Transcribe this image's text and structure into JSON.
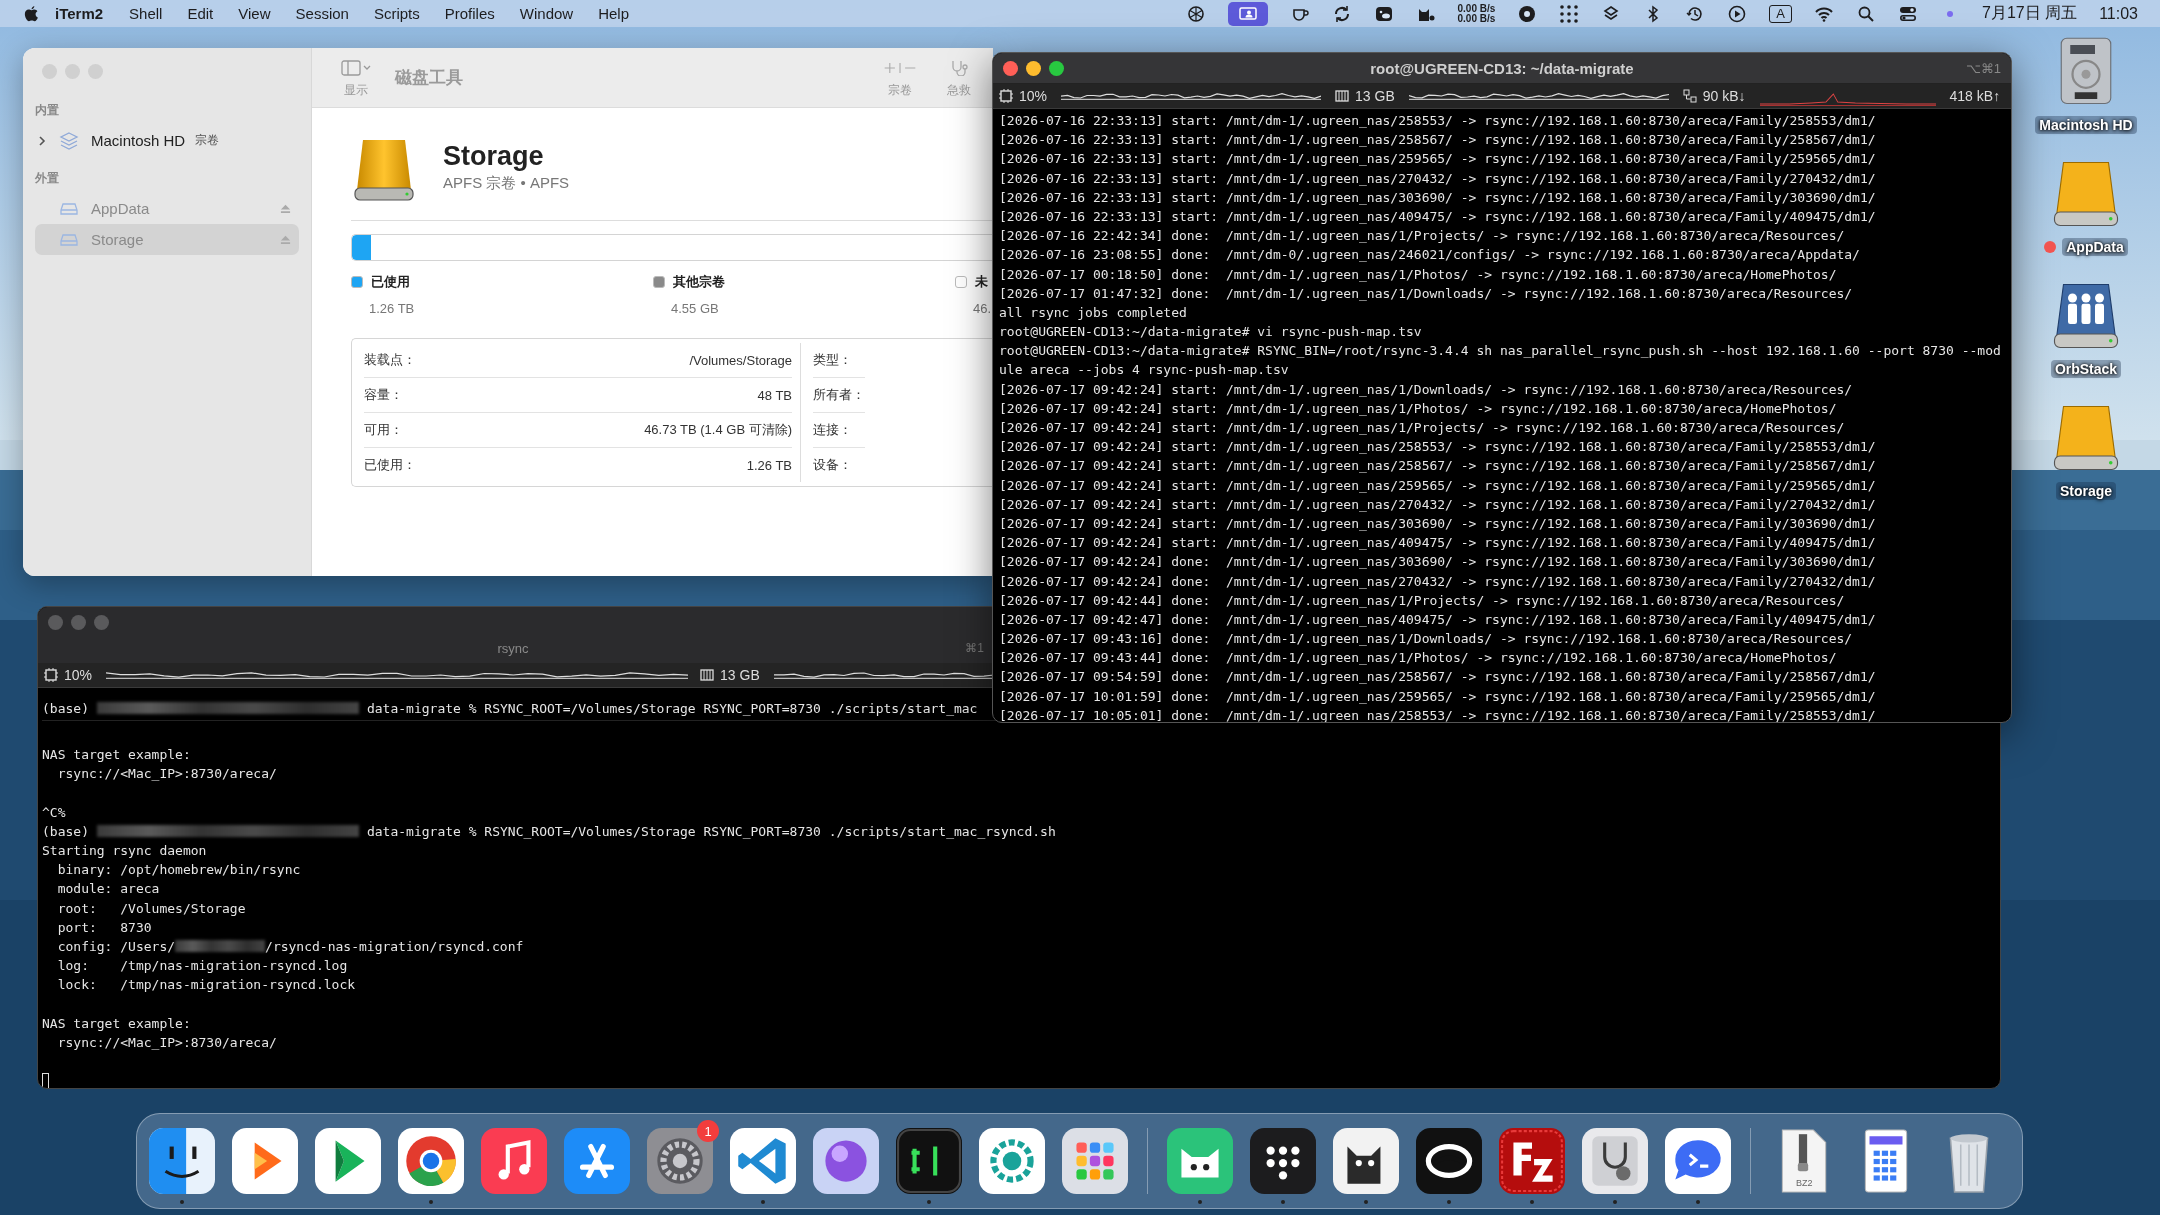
{
  "menu_bar": {
    "app_name": "iTerm2",
    "menus": [
      "Shell",
      "Edit",
      "View",
      "Session",
      "Scripts",
      "Profiles",
      "Window",
      "Help"
    ],
    "status_items": [
      {
        "kind": "icon",
        "highlighted": false
      },
      {
        "kind": "icon",
        "highlighted": true
      },
      {
        "kind": "icon",
        "highlighted": false
      },
      {
        "kind": "icon",
        "highlighted": false
      },
      {
        "kind": "icon",
        "highlighted": false
      },
      {
        "kind": "icon",
        "highlighted": false
      },
      {
        "kind": "speed",
        "lines": [
          "0.00 B/s",
          "0.00 B/s"
        ]
      },
      {
        "kind": "icon",
        "highlighted": false
      },
      {
        "kind": "icon",
        "highlighted": false
      },
      {
        "kind": "icon",
        "highlighted": false
      },
      {
        "kind": "icon",
        "highlighted": false
      },
      {
        "kind": "icon",
        "highlighted": false
      },
      {
        "kind": "icon",
        "highlighted": false
      },
      {
        "kind": "input",
        "text": "A"
      },
      {
        "kind": "icon",
        "highlighted": false
      },
      {
        "kind": "icon",
        "highlighted": false
      },
      {
        "kind": "icon",
        "highlighted": false
      },
      {
        "kind": "icon",
        "highlighted": false
      },
      {
        "kind": "text",
        "text": "7月17日 周五"
      },
      {
        "kind": "text",
        "text": "11:03"
      }
    ]
  },
  "disk_utility": {
    "title": "磁盘工具",
    "view_label": "显示",
    "volume_label": "宗卷",
    "first_aid_label": "急救",
    "sidebar": [
      {
        "heading": "内置",
        "items": [
          {
            "name": "Macintosh HD",
            "tag": "宗卷",
            "kind": "container",
            "expanded": false,
            "selected": false
          }
        ]
      },
      {
        "heading": "外置",
        "items": [
          {
            "name": "AppData",
            "kind": "volume",
            "ejectable": true,
            "selected": false
          },
          {
            "name": "Storage",
            "kind": "volume",
            "ejectable": true,
            "selected": true
          }
        ]
      }
    ],
    "volume": {
      "name": "Storage",
      "subtitle": "APFS 宗卷 • APFS"
    },
    "usage": {
      "level": 0.03,
      "legend": [
        {
          "label": "已使用",
          "value": "1.26 TB",
          "color": "#1ea5f3"
        },
        {
          "label": "其他宗卷",
          "value": "4.55 GB",
          "color": "#8a8a8a"
        },
        {
          "label": "未",
          "value": "46.",
          "color": "#ffffff"
        }
      ]
    },
    "info_left": [
      {
        "label": "装载点：",
        "value": "/Volumes/Storage"
      },
      {
        "label": "容量：",
        "value": "48 TB"
      },
      {
        "label": "可用：",
        "value": "46.73 TB (1.4 GB 可清除)"
      },
      {
        "label": "已使用：",
        "value": "1.26 TB"
      }
    ],
    "info_right": [
      "类型：",
      "所有者：",
      "连接：",
      "设备："
    ]
  },
  "terminal_front": {
    "title": "root@UGREEN-CD13: ~/data-migrate",
    "shortcut": "⌥⌘1",
    "status_bar": [
      {
        "kind": "cpu",
        "text": "10%"
      },
      {
        "kind": "memory",
        "text": "13 GB"
      },
      {
        "kind": "network",
        "text": "90 kB↓",
        "text2": "418 kB↑"
      }
    ],
    "lines": [
      "[2026-07-16 22:33:13] start: /mnt/dm-1/.ugreen_nas/258553/ -> rsync://192.168.1.60:8730/areca/Family/258553/dm1/",
      "[2026-07-16 22:33:13] start: /mnt/dm-1/.ugreen_nas/258567/ -> rsync://192.168.1.60:8730/areca/Family/258567/dm1/",
      "[2026-07-16 22:33:13] start: /mnt/dm-1/.ugreen_nas/259565/ -> rsync://192.168.1.60:8730/areca/Family/259565/dm1/",
      "[2026-07-16 22:33:13] start: /mnt/dm-1/.ugreen_nas/270432/ -> rsync://192.168.1.60:8730/areca/Family/270432/dm1/",
      "[2026-07-16 22:33:13] start: /mnt/dm-1/.ugreen_nas/303690/ -> rsync://192.168.1.60:8730/areca/Family/303690/dm1/",
      "[2026-07-16 22:33:13] start: /mnt/dm-1/.ugreen_nas/409475/ -> rsync://192.168.1.60:8730/areca/Family/409475/dm1/",
      "[2026-07-16 22:42:34] done:  /mnt/dm-1/.ugreen_nas/1/Projects/ -> rsync://192.168.1.60:8730/areca/Resources/",
      "[2026-07-16 23:08:55] done:  /mnt/dm-0/.ugreen_nas/246021/configs/ -> rsync://192.168.1.60:8730/areca/Appdata/",
      "[2026-07-17 00:18:50] done:  /mnt/dm-1/.ugreen_nas/1/Photos/ -> rsync://192.168.1.60:8730/areca/HomePhotos/",
      "[2026-07-17 01:47:32] done:  /mnt/dm-1/.ugreen_nas/1/Downloads/ -> rsync://192.168.1.60:8730/areca/Resources/",
      "all rsync jobs completed",
      "root@UGREEN-CD13:~/data-migrate# vi rsync-push-map.tsv",
      "root@UGREEN-CD13:~/data-migrate# RSYNC_BIN=/root/rsync-3.4.4 sh nas_parallel_rsync_push.sh --host 192.168.1.60 --port 8730 --mod",
      "ule areca --jobs 4 rsync-push-map.tsv",
      "[2026-07-17 09:42:24] start: /mnt/dm-1/.ugreen_nas/1/Downloads/ -> rsync://192.168.1.60:8730/areca/Resources/",
      "[2026-07-17 09:42:24] start: /mnt/dm-1/.ugreen_nas/1/Photos/ -> rsync://192.168.1.60:8730/areca/HomePhotos/",
      "[2026-07-17 09:42:24] start: /mnt/dm-1/.ugreen_nas/1/Projects/ -> rsync://192.168.1.60:8730/areca/Resources/",
      "[2026-07-17 09:42:24] start: /mnt/dm-1/.ugreen_nas/258553/ -> rsync://192.168.1.60:8730/areca/Family/258553/dm1/",
      "[2026-07-17 09:42:24] start: /mnt/dm-1/.ugreen_nas/258567/ -> rsync://192.168.1.60:8730/areca/Family/258567/dm1/",
      "[2026-07-17 09:42:24] start: /mnt/dm-1/.ugreen_nas/259565/ -> rsync://192.168.1.60:8730/areca/Family/259565/dm1/",
      "[2026-07-17 09:42:24] start: /mnt/dm-1/.ugreen_nas/270432/ -> rsync://192.168.1.60:8730/areca/Family/270432/dm1/",
      "[2026-07-17 09:42:24] start: /mnt/dm-1/.ugreen_nas/303690/ -> rsync://192.168.1.60:8730/areca/Family/303690/dm1/",
      "[2026-07-17 09:42:24] start: /mnt/dm-1/.ugreen_nas/409475/ -> rsync://192.168.1.60:8730/areca/Family/409475/dm1/",
      "[2026-07-17 09:42:24] done:  /mnt/dm-1/.ugreen_nas/303690/ -> rsync://192.168.1.60:8730/areca/Family/303690/dm1/",
      "[2026-07-17 09:42:24] done:  /mnt/dm-1/.ugreen_nas/270432/ -> rsync://192.168.1.60:8730/areca/Family/270432/dm1/",
      "[2026-07-17 09:42:44] done:  /mnt/dm-1/.ugreen_nas/1/Projects/ -> rsync://192.168.1.60:8730/areca/Resources/",
      "[2026-07-17 09:42:47] done:  /mnt/dm-1/.ugreen_nas/409475/ -> rsync://192.168.1.60:8730/areca/Family/409475/dm1/",
      "[2026-07-17 09:43:16] done:  /mnt/dm-1/.ugreen_nas/1/Downloads/ -> rsync://192.168.1.60:8730/areca/Resources/",
      "[2026-07-17 09:43:44] done:  /mnt/dm-1/.ugreen_nas/1/Photos/ -> rsync://192.168.1.60:8730/areca/HomePhotos/",
      "[2026-07-17 09:54:59] done:  /mnt/dm-1/.ugreen_nas/258567/ -> rsync://192.168.1.60:8730/areca/Family/258567/dm1/",
      "[2026-07-17 10:01:59] done:  /mnt/dm-1/.ugreen_nas/259565/ -> rsync://192.168.1.60:8730/areca/Family/259565/dm1/",
      "[2026-07-17 10:05:01] done:  /mnt/dm-1/.ugreen_nas/258553/ -> rsync://192.168.1.60:8730/areca/Family/258553/dm1/"
    ]
  },
  "terminal_back": {
    "title": "rsync",
    "shortcut": "⌘1",
    "status_bar": [
      {
        "kind": "cpu",
        "text": "10%"
      },
      {
        "kind": "memory",
        "text": "13 GB"
      }
    ],
    "pinned_line": [
      "(base)",
      "data-migrate % RSYNC_ROOT=/Volumes/Storage RSYNC_PORT=8730 ./scripts/start_mac"
    ],
    "lines": [
      {
        "kind": "text",
        "text": "NAS target example:"
      },
      {
        "kind": "text",
        "text": "  rsync://<Mac_IP>:8730/areca/"
      },
      {
        "kind": "blank"
      },
      {
        "kind": "text",
        "text": "^C%"
      },
      {
        "kind": "redacted",
        "parts": [
          "(base)",
          "data-migrate % RSYNC_ROOT=/Volumes/Storage RSYNC_PORT=8730 ./scripts/start_mac_rsyncd.sh"
        ]
      },
      {
        "kind": "text",
        "text": "Starting rsync daemon"
      },
      {
        "kind": "text",
        "text": "  binary: /opt/homebrew/bin/rsync"
      },
      {
        "kind": "text",
        "text": "  module: areca"
      },
      {
        "kind": "text",
        "text": "  root:   /Volumes/Storage"
      },
      {
        "kind": "text",
        "text": "  port:   8730"
      },
      {
        "kind": "redacted",
        "parts": [
          "  config: /Users/",
          "/rsyncd-nas-migration/rsyncd.conf"
        ]
      },
      {
        "kind": "text",
        "text": "  log:    /tmp/nas-migration-rsyncd.log"
      },
      {
        "kind": "text",
        "text": "  lock:   /tmp/nas-migration-rsyncd.lock"
      },
      {
        "kind": "blank"
      },
      {
        "kind": "text",
        "text": "NAS target example:"
      },
      {
        "kind": "text",
        "text": "  rsync://<Mac_IP>:8730/areca/"
      },
      {
        "kind": "blank"
      },
      {
        "kind": "cursor"
      }
    ]
  },
  "desktop_icons": [
    {
      "label": "Macintosh HD",
      "kind": "internal"
    },
    {
      "label": "AppData",
      "kind": "external",
      "color": "#f25450"
    },
    {
      "label": "OrbStack",
      "kind": "shared"
    },
    {
      "label": "Storage",
      "kind": "external"
    }
  ],
  "dock": [
    {
      "kind": "app",
      "running": true
    },
    {
      "kind": "app",
      "running": false
    },
    {
      "kind": "app",
      "running": false
    },
    {
      "kind": "app",
      "running": true
    },
    {
      "kind": "app",
      "running": false
    },
    {
      "kind": "app",
      "running": false
    },
    {
      "kind": "app",
      "running": false,
      "badge": "1"
    },
    {
      "kind": "app",
      "running": true
    },
    {
      "kind": "app",
      "running": false
    },
    {
      "kind": "app",
      "running": true
    },
    {
      "kind": "app",
      "running": false
    },
    {
      "kind": "app",
      "running": false
    },
    {
      "kind": "separator"
    },
    {
      "kind": "app",
      "running": true
    },
    {
      "kind": "app",
      "running": true
    },
    {
      "kind": "app",
      "running": true
    },
    {
      "kind": "app",
      "running": true
    },
    {
      "kind": "app",
      "running": true
    },
    {
      "kind": "app",
      "running": true
    },
    {
      "kind": "app",
      "running": true
    },
    {
      "kind": "separator"
    },
    {
      "kind": "file",
      "label": "BZ2"
    },
    {
      "kind": "file"
    },
    {
      "kind": "trash"
    }
  ]
}
